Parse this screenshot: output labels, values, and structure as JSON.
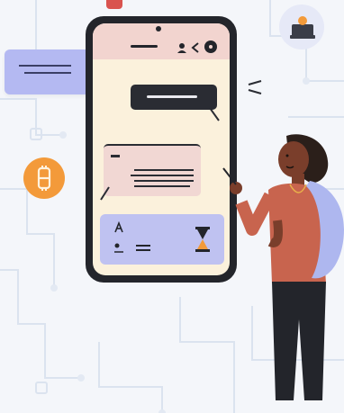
{
  "colors": {
    "background": "#f4f6fa",
    "circuit_lines": "#d9e1ee",
    "phone_frame": "#23252b",
    "phone_screen": "#fbf1dc",
    "phone_header": "#f2d4cf",
    "incoming_bubble": "#f1d7d3",
    "outgoing_bubble": "#2a2c33",
    "composer": "#bfc2f1",
    "floating_card": "#b4b9f2",
    "coin": "#f39a3a",
    "person_top": "#c8644e",
    "person_pants": "#23252b",
    "person_skin": "#7a3e2b",
    "person_hair": "#2b1f1a",
    "bag": "#aeb7ef"
  },
  "icons": {
    "status_icon": "user-icon",
    "back_icon": "back-arrow-icon",
    "menu_icon": "more-icon",
    "composer_icon_1": "aa-text-icon",
    "composer_icon_2": "emoji-icon",
    "send_icon": "hourglass-icon",
    "coin_icon": "bitcoin-coin-icon",
    "badge_icon": "profile-card-icon"
  }
}
